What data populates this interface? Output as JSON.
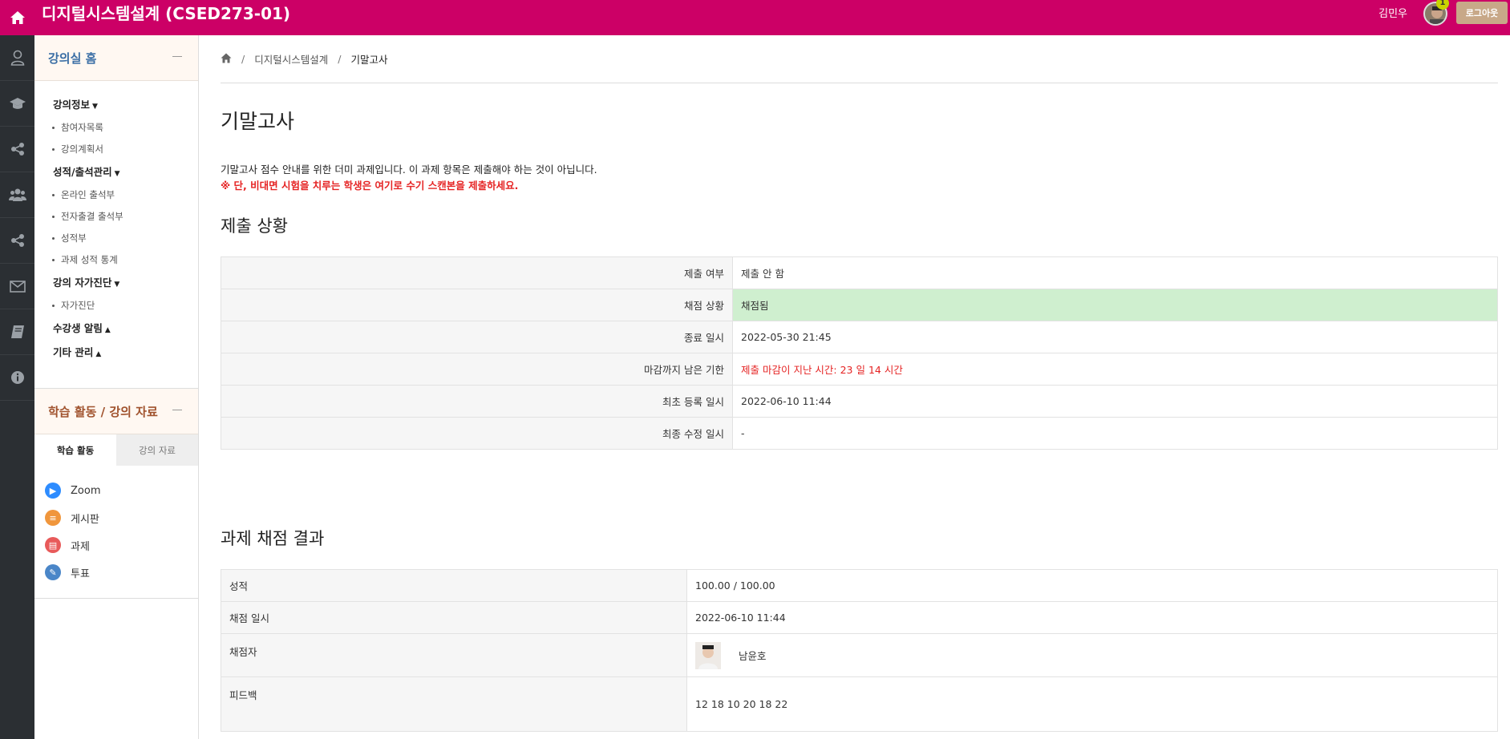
{
  "topbar": {
    "title": "디지털시스템설계 (CSED273-01)",
    "username": "김민우",
    "badge": "1",
    "logout_label": "로그아웃",
    "color": "#cc0066"
  },
  "iconbar": {
    "icons": [
      "user-icon",
      "graduation-cap-icon",
      "share-icon",
      "users-icon",
      "share-icon",
      "mail-icon",
      "book-icon",
      "info-icon"
    ]
  },
  "sidebar": {
    "header1": "강의실 홈",
    "menu": [
      {
        "type": "cat",
        "label": "강의정보",
        "caret": "▼"
      },
      {
        "type": "item",
        "label": "참여자목록"
      },
      {
        "type": "item",
        "label": "강의계획서"
      },
      {
        "type": "cat",
        "label": "성적/출석관리",
        "caret": "▼"
      },
      {
        "type": "item",
        "label": "온라인 출석부"
      },
      {
        "type": "item",
        "label": "전자출결 출석부"
      },
      {
        "type": "item",
        "label": "성적부"
      },
      {
        "type": "item",
        "label": "과제 성적 통계"
      },
      {
        "type": "cat",
        "label": "강의 자가진단",
        "caret": "▼"
      },
      {
        "type": "item",
        "label": "자가진단"
      },
      {
        "type": "cat",
        "label": "수강생 알림",
        "caret": "▲"
      },
      {
        "type": "cat",
        "label": "기타 관리",
        "caret": "▲"
      }
    ],
    "header2": "학습 활동 / 강의 자료",
    "tabs": {
      "active": "학습 활동",
      "inactive": "강의 자료"
    },
    "activities": [
      {
        "label": "Zoom",
        "icon": "zoom-icon",
        "color": "#2d8cff"
      },
      {
        "label": "게시판",
        "icon": "board-icon",
        "color": "#f0963c"
      },
      {
        "label": "과제",
        "icon": "assignment-icon",
        "color": "#e85a5a"
      },
      {
        "label": "투표",
        "icon": "vote-icon",
        "color": "#4a86c8"
      }
    ]
  },
  "breadcrumb": {
    "course": "디지털시스템설계",
    "current": "기말고사",
    "sep": "/"
  },
  "page": {
    "title": "기말고사",
    "desc": "기말고사 점수 안내를 위한 더미 과제입니다. 이 과제 항목은 제출해야 하는 것이 아닙니다.",
    "warning": "※ 단, 비대면 시험을 치루는 학생은 여기로 수기 스캔본을 제출하세요."
  },
  "submission": {
    "heading": "제출 상황",
    "rows": [
      {
        "key": "제출 여부",
        "value": "제출 안 함"
      },
      {
        "key": "채점 상황",
        "value": "채점됨"
      },
      {
        "key": "종료 일시",
        "value": "2022-05-30 21:45"
      },
      {
        "key": "마감까지 남은 기한",
        "value": "제출 마감이 지난 시간: 23 일 14 시간"
      },
      {
        "key": "최초 등록 일시",
        "value": "2022-06-10 11:44"
      },
      {
        "key": "최종 수정 일시",
        "value": "-"
      }
    ]
  },
  "grading": {
    "heading": "과제 채점 결과",
    "rows": [
      {
        "key": "성적",
        "value": "100.00 / 100.00"
      },
      {
        "key": "채점 일시",
        "value": "2022-06-10 11:44"
      },
      {
        "key": "채점자",
        "value": "남윤호"
      },
      {
        "key": "피드백",
        "value": "12 18 10 20 18 22"
      }
    ]
  }
}
